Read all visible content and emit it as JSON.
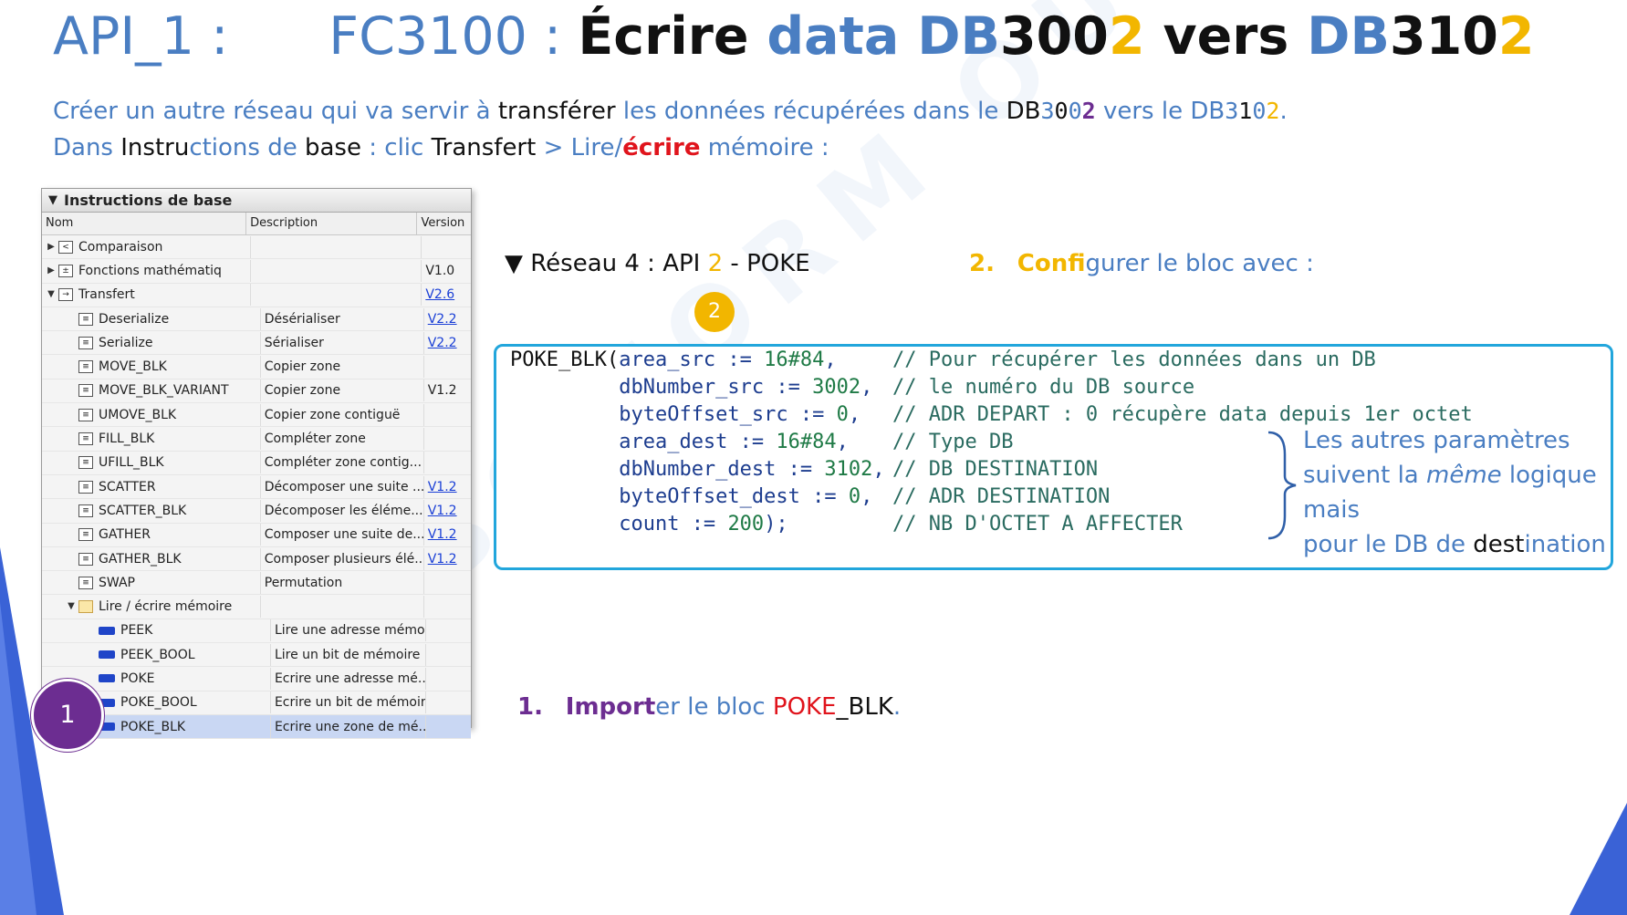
{
  "title": {
    "api_prefix": "API_",
    "api_num": "1",
    "api_colon": " :",
    "fc": "FC3100 : ",
    "ecrire": "Écrire ",
    "data": "data ",
    "db1_a": "DB",
    "db1_b": "300",
    "db1_c": "2",
    "vers": " vers ",
    "db2_a": "DB",
    "db2_b": "310",
    "db2_c": "2"
  },
  "intro": {
    "line1_a": "Créer un autre réseau qui va servir à ",
    "line1_b": "transférer",
    "line1_c": " les données récupérées dans le ",
    "line1_d": "DB",
    "line1_e": "3",
    "line1_f": "0",
    "line1_g": "0",
    "line1_h": "2",
    "line1_i": " vers le ",
    "line1_j": "DB",
    "line1_k": "3",
    "line1_l": "1",
    "line1_m": "0",
    "line1_n": "2",
    "line1_o": ".",
    "line2_a": "Dans ",
    "line2_b": "Instru",
    "line2_c": "ctions de ",
    "line2_d": "base",
    "line2_e": " : clic ",
    "line2_f": "Transfert",
    "line2_g": " > Lire/",
    "line2_h": "écrire",
    "line2_i": " mémoire :"
  },
  "panel": {
    "header": "Instructions de base",
    "col_name": "Nom",
    "col_desc": "Description",
    "col_ver": "Version",
    "rows": [
      {
        "level": 0,
        "tri": "▶",
        "icon": "compare",
        "name": "Comparaison",
        "desc": "",
        "ver": "",
        "link": false
      },
      {
        "level": 0,
        "tri": "▶",
        "icon": "math",
        "name": "Fonctions mathématiq",
        "desc": "",
        "ver": "V1.0",
        "link": false
      },
      {
        "level": 0,
        "tri": "▼",
        "icon": "transfer",
        "name": "Transfert",
        "desc": "",
        "ver": "V2.6",
        "link": true
      },
      {
        "level": 1,
        "tri": "",
        "icon": "block",
        "name": "Deserialize",
        "desc": "Désérialiser",
        "ver": "V2.2",
        "link": true
      },
      {
        "level": 1,
        "tri": "",
        "icon": "block",
        "name": "Serialize",
        "desc": "Sérialiser",
        "ver": "V2.2",
        "link": true
      },
      {
        "level": 1,
        "tri": "",
        "icon": "block",
        "name": "MOVE_BLK",
        "desc": "Copier zone",
        "ver": "",
        "link": false
      },
      {
        "level": 1,
        "tri": "",
        "icon": "block",
        "name": "MOVE_BLK_VARIANT",
        "desc": "Copier zone",
        "ver": "V1.2",
        "link": false
      },
      {
        "level": 1,
        "tri": "",
        "icon": "block",
        "name": "UMOVE_BLK",
        "desc": "Copier zone contiguë",
        "ver": "",
        "link": false
      },
      {
        "level": 1,
        "tri": "",
        "icon": "block",
        "name": "FILL_BLK",
        "desc": "Compléter zone",
        "ver": "",
        "link": false
      },
      {
        "level": 1,
        "tri": "",
        "icon": "block",
        "name": "UFILL_BLK",
        "desc": "Compléter zone contig...",
        "ver": "",
        "link": false
      },
      {
        "level": 1,
        "tri": "",
        "icon": "block",
        "name": "SCATTER",
        "desc": "Décomposer une suite ...",
        "ver": "V1.2",
        "link": true
      },
      {
        "level": 1,
        "tri": "",
        "icon": "block",
        "name": "SCATTER_BLK",
        "desc": "Décomposer les éléme...",
        "ver": "V1.2",
        "link": true
      },
      {
        "level": 1,
        "tri": "",
        "icon": "block",
        "name": "GATHER",
        "desc": "Composer une suite de...",
        "ver": "V1.2",
        "link": true
      },
      {
        "level": 1,
        "tri": "",
        "icon": "block",
        "name": "GATHER_BLK",
        "desc": "Composer plusieurs élé...",
        "ver": "V1.2",
        "link": true
      },
      {
        "level": 1,
        "tri": "",
        "icon": "block",
        "name": "SWAP",
        "desc": "Permutation",
        "ver": "",
        "link": false
      },
      {
        "level": 1,
        "tri": "▼",
        "icon": "folder",
        "name": "Lire / écrire mémoire",
        "desc": "",
        "ver": "",
        "link": false
      },
      {
        "level": 2,
        "tri": "",
        "icon": "fb",
        "name": "PEEK",
        "desc": "Lire une adresse mémo...",
        "ver": "",
        "link": false
      },
      {
        "level": 2,
        "tri": "",
        "icon": "fb",
        "name": "PEEK_BOOL",
        "desc": "Lire un bit de mémoire",
        "ver": "",
        "link": false
      },
      {
        "level": 2,
        "tri": "",
        "icon": "fb",
        "name": "POKE",
        "desc": "Ecrire une adresse mé...",
        "ver": "",
        "link": false
      },
      {
        "level": 2,
        "tri": "",
        "icon": "fb",
        "name": "POKE_BOOL",
        "desc": "Ecrire un bit de mémoire",
        "ver": "",
        "link": false
      },
      {
        "level": 2,
        "tri": "",
        "icon": "fb",
        "name": "POKE_BLK",
        "desc": "Ecrire une zone de mé...",
        "ver": "",
        "link": false,
        "selected": true
      }
    ]
  },
  "badges": {
    "one": "1",
    "two": "2"
  },
  "reseau": {
    "arrow": "▼",
    "a": " Réseau 4 : API ",
    "b": "2",
    "c": " - POKE"
  },
  "config": {
    "num": "2.",
    "a": "Confi",
    "b": "gurer le bloc avec :"
  },
  "code": {
    "lines": [
      {
        "a": "POKE_BLK(",
        "b": "area_src := ",
        "n": "16#84",
        ",": ",",
        "cmt": "// Pour récupérer les données dans un DB"
      },
      {
        "a": "         ",
        "b": "dbNumber_src := ",
        "n": "3002",
        ",": ",",
        "cmt": "// le numéro du DB source"
      },
      {
        "a": "         ",
        "b": "byteOffset_src := ",
        "n": "0",
        ",": ",",
        "cmt": "// ADR DEPART : 0 récupère data depuis 1er octet"
      },
      {
        "a": "         ",
        "b": "area_dest := ",
        "n": "16#84",
        ",": ",",
        "cmt": "// Type DB"
      },
      {
        "a": "         ",
        "b": "dbNumber_dest := ",
        "n": "3102",
        ",": ",",
        "cmt": "// DB DESTINATION"
      },
      {
        "a": "         ",
        "b": "byteOffset_dest := ",
        "n": "0",
        ",": ",",
        "cmt": "// ADR DESTINATION"
      },
      {
        "a": "         ",
        "b": "count := ",
        "n": "200",
        ",": ");",
        "cmt": "// NB D'OCTET A AFFECTER"
      }
    ],
    "other_1": "Les autres paramètres",
    "other_2a": "suivent la ",
    "other_2b": "même",
    "other_2c": " logique",
    "other_3": "mais",
    "other_4a": "pour le DB de ",
    "other_4b": "dest",
    "other_4c": "ination"
  },
  "import": {
    "num": "1.",
    "a": "Import",
    "b": "er le bloc ",
    "c": "POKE",
    "d": "_BLK",
    "e": "."
  },
  "watermark": "ABC FORM OUEST",
  "colors": {
    "accent_blue": "#4a7ec2",
    "orange": "#f2b600",
    "red": "#e0141c",
    "purple": "#6c2d91",
    "code_border": "#22a6dc",
    "corner_blue": "#3a62d6"
  }
}
